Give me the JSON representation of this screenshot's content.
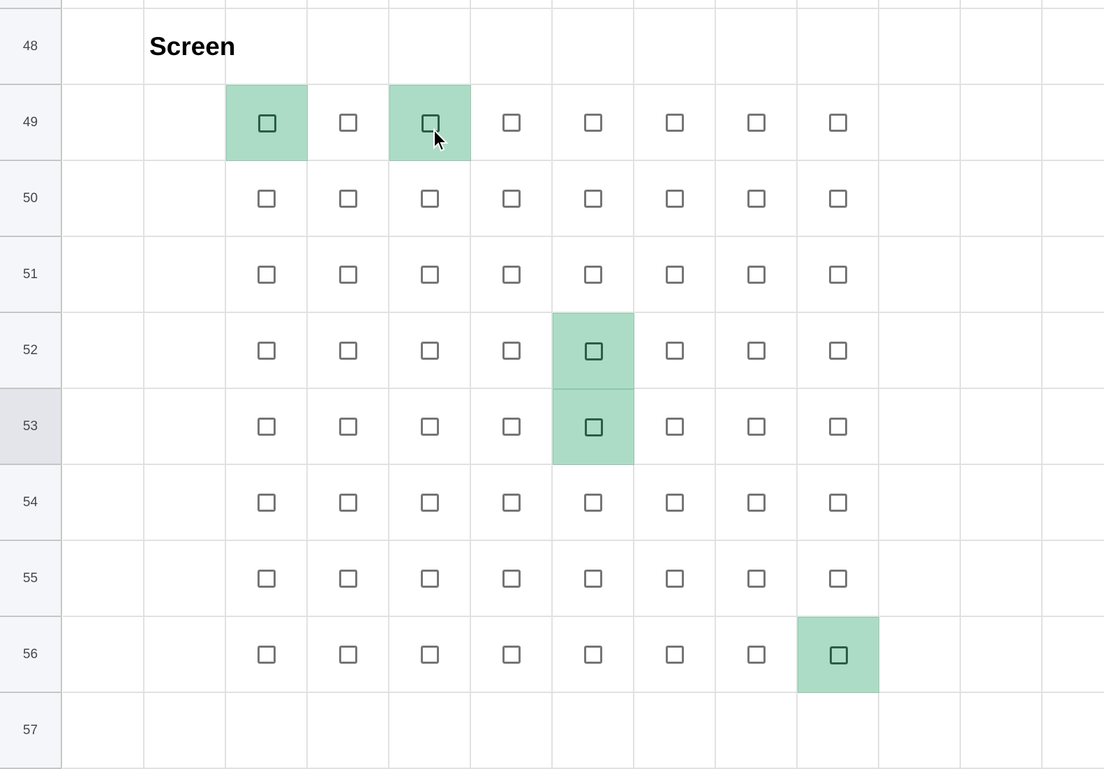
{
  "sheet": {
    "rows": [
      {
        "label": "48",
        "title": "Screen"
      },
      {
        "label": "49"
      },
      {
        "label": "50"
      },
      {
        "label": "51"
      },
      {
        "label": "52"
      },
      {
        "label": "53",
        "selected": true
      },
      {
        "label": "54"
      },
      {
        "label": "55"
      },
      {
        "label": "56"
      },
      {
        "label": "57"
      }
    ],
    "checkbox_rows": [
      "49",
      "50",
      "51",
      "52",
      "53",
      "54",
      "55",
      "56"
    ],
    "checkbox_columns": 8,
    "checked": [],
    "highlighted_cells": [
      {
        "row": "49",
        "checkbox_col": 1
      },
      {
        "row": "49",
        "checkbox_col": 3
      },
      {
        "row": "52",
        "checkbox_col": 5
      },
      {
        "row": "53",
        "checkbox_col": 5
      },
      {
        "row": "56",
        "checkbox_col": 8
      }
    ],
    "highlight_color": "#acdcc6"
  }
}
